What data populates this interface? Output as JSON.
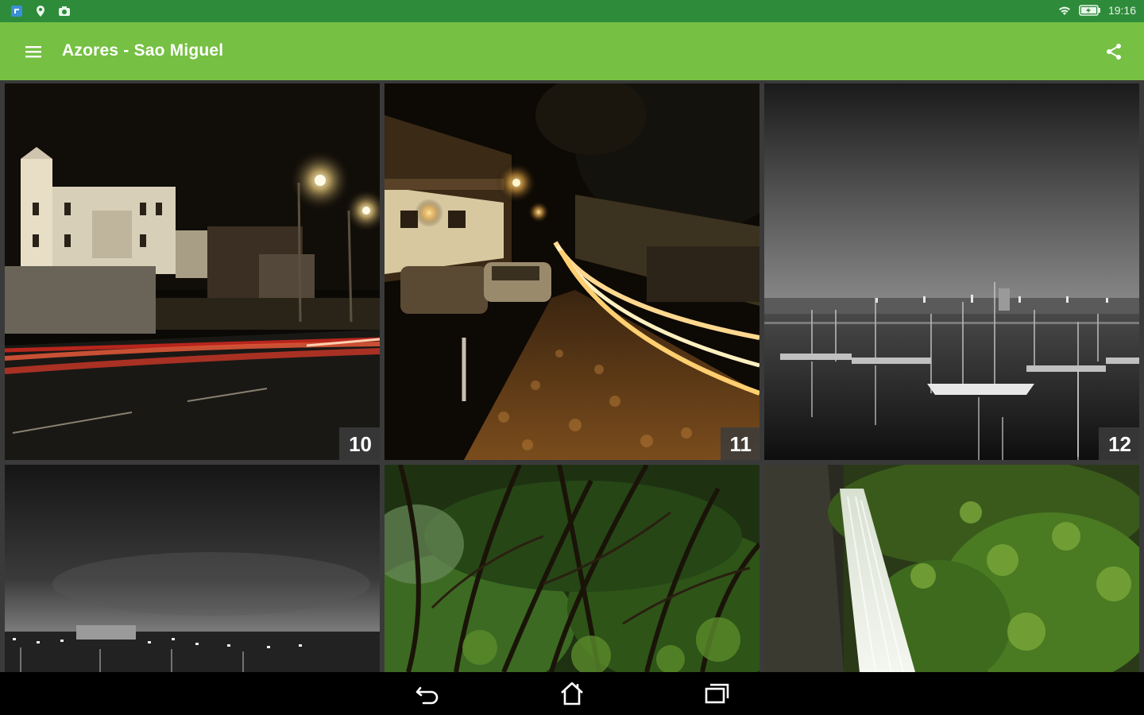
{
  "status_bar": {
    "time": "19:16",
    "left_icons": [
      "app-notification-icon",
      "location-pin-icon",
      "camera-icon"
    ],
    "right_icons": [
      "wifi-icon",
      "battery-charging-icon"
    ]
  },
  "app_bar": {
    "title": "Azores - Sao Miguel",
    "menu_icon": "hamburger-menu-icon",
    "share_icon": "share-icon",
    "color": "#76c043"
  },
  "photos": [
    {
      "number": "10",
      "subject": "church-night-light-trails"
    },
    {
      "number": "11",
      "subject": "cobblestone-street-light-trails"
    },
    {
      "number": "12",
      "subject": "harbor-marina-black-white"
    },
    {
      "number": "",
      "subject": "city-night-black-white"
    },
    {
      "number": "",
      "subject": "forest-trees"
    },
    {
      "number": "",
      "subject": "waterfall-jungle"
    }
  ],
  "nav_bar": {
    "icons": [
      "back-icon",
      "home-icon",
      "recent-apps-icon"
    ]
  }
}
